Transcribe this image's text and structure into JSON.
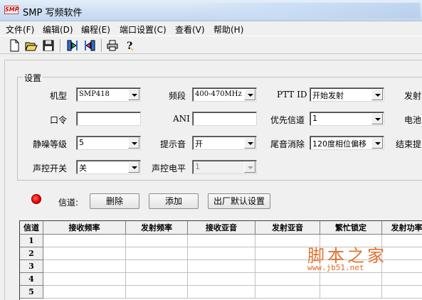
{
  "window": {
    "title": "SMP 写频软件",
    "logo": "SMP"
  },
  "menu": [
    {
      "label": "文件(F)"
    },
    {
      "label": "编辑(D)"
    },
    {
      "label": "编程(E)"
    },
    {
      "label": "端口设置(C)"
    },
    {
      "label": "查看(V)"
    },
    {
      "label": "帮助(H)"
    }
  ],
  "toolbar": {
    "icons": [
      "new-document-icon",
      "open-folder-icon",
      "save-disk-icon",
      "read-from-radio-icon",
      "write-to-radio-icon",
      "print-icon",
      "help-icon"
    ]
  },
  "settings": {
    "group_title": "设置",
    "model": {
      "label": "机型",
      "value": "SMP418"
    },
    "band": {
      "label": "频段",
      "value": "400-470MHz"
    },
    "ptt_id": {
      "label": "PTT ID",
      "value": "开始发射"
    },
    "tx_cut": {
      "label": "发射"
    },
    "password": {
      "label": "口令",
      "value": ""
    },
    "ani": {
      "label": "ANI",
      "value": ""
    },
    "priority_channel": {
      "label": "优先信道",
      "value": "1"
    },
    "battery_cut": {
      "label": "电池"
    },
    "squelch": {
      "label": "静噪等级",
      "value": "5"
    },
    "beep": {
      "label": "提示音",
      "value": "开"
    },
    "tail_elim": {
      "label": "尾音消除",
      "value": "120度相位偏移"
    },
    "end_cut": {
      "label": "结束提"
    },
    "vox_switch": {
      "label": "声控开关",
      "value": "关"
    },
    "vox_level": {
      "label": "声控电平",
      "value": "1"
    }
  },
  "channel_bar": {
    "label": "信道:",
    "delete_label": "删除",
    "add_label": "添加",
    "factory_label": "出厂默认设置"
  },
  "table": {
    "headers": [
      "信道",
      "接收频率",
      "发射频率",
      "接收亚音",
      "发射亚音",
      "繁忙锁定",
      "发射功率"
    ],
    "row_numbers": [
      "1",
      "2",
      "3",
      "4",
      "5"
    ]
  },
  "watermark": {
    "text": "脚本之家",
    "url": "www.jb51.net"
  },
  "colors": {
    "led": "#e00000",
    "watermark": "#e36a26",
    "title_bar": "#cfe0f3"
  }
}
